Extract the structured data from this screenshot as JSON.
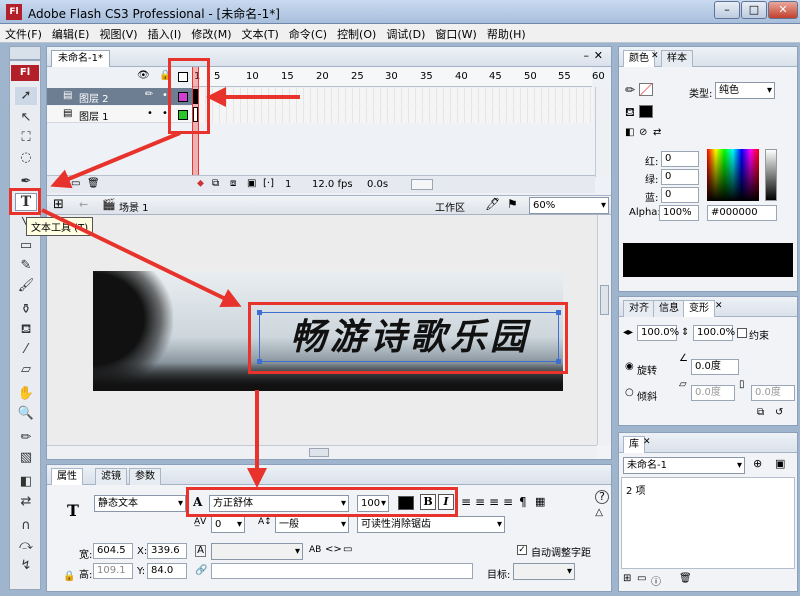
{
  "window": {
    "app_logo": "Fl",
    "title": "Adobe Flash CS3 Professional - [未命名-1*]",
    "minimize": "–",
    "maximize": "□",
    "close": "✕"
  },
  "menu": [
    "文件(F)",
    "编辑(E)",
    "视图(V)",
    "插入(I)",
    "修改(M)",
    "文本(T)",
    "命令(C)",
    "控制(O)",
    "调试(D)",
    "窗口(W)",
    "帮助(H)"
  ],
  "document": {
    "tab_label": "未命名-1*",
    "timeline": {
      "frame_numbers": [
        "1",
        "5",
        "10",
        "15",
        "20",
        "25",
        "30",
        "35",
        "40",
        "45",
        "50",
        "55",
        "60",
        "65"
      ],
      "layers": [
        {
          "name": "图层 2",
          "selected": true
        },
        {
          "name": "图层 1",
          "selected": false
        }
      ],
      "status": {
        "current_frame": "1",
        "fps": "12.0 fps",
        "time": "0.0s"
      }
    },
    "edit_bar": {
      "scene": "场景 1",
      "workspace": "工作区",
      "zoom": "60%"
    },
    "stage_text": "畅游诗歌乐园"
  },
  "tooltip": "文本工具 (T)",
  "properties": {
    "tabs": [
      "属性",
      "滤镜",
      "参数"
    ],
    "text_type": "静态文本",
    "font_family": "方正舒体",
    "font_size": "100",
    "bold": "B",
    "italic": "I",
    "letter_spacing": "0",
    "baseline": "一般",
    "antialias": "可读性消除锯齿",
    "width_label": "宽:",
    "width": "604.5",
    "x_label": "X:",
    "x": "339.6",
    "height_label": "高:",
    "height": "109.1",
    "y_label": "Y:",
    "y": "84.0",
    "auto_kern": "自动调整字距",
    "target_label": "目标:"
  },
  "color_panel": {
    "tabs": [
      "颜色",
      "样本"
    ],
    "type_label": "类型:",
    "type": "纯色",
    "red_label": "红:",
    "red": "0",
    "green_label": "绿:",
    "green": "0",
    "blue_label": "蓝:",
    "blue": "0",
    "alpha_label": "Alpha:",
    "alpha": "100%",
    "hex": "#000000"
  },
  "transform_panel": {
    "tabs": [
      "对齐",
      "信息",
      "变形"
    ],
    "scale_w": "100.0%",
    "scale_h": "100.0%",
    "constrain": "约束",
    "rotate_label": "旋转",
    "rotate": "0.0度",
    "skew_label": "倾斜",
    "skew_h": "0.0度",
    "skew_v": "0.0度"
  },
  "library_panel": {
    "tab": "库",
    "document": "未命名-1",
    "count": "2 项"
  },
  "colors": {
    "annotation_red": "#e8322c",
    "layer2_outline": "#d040d0",
    "layer1_outline": "#28c828"
  }
}
